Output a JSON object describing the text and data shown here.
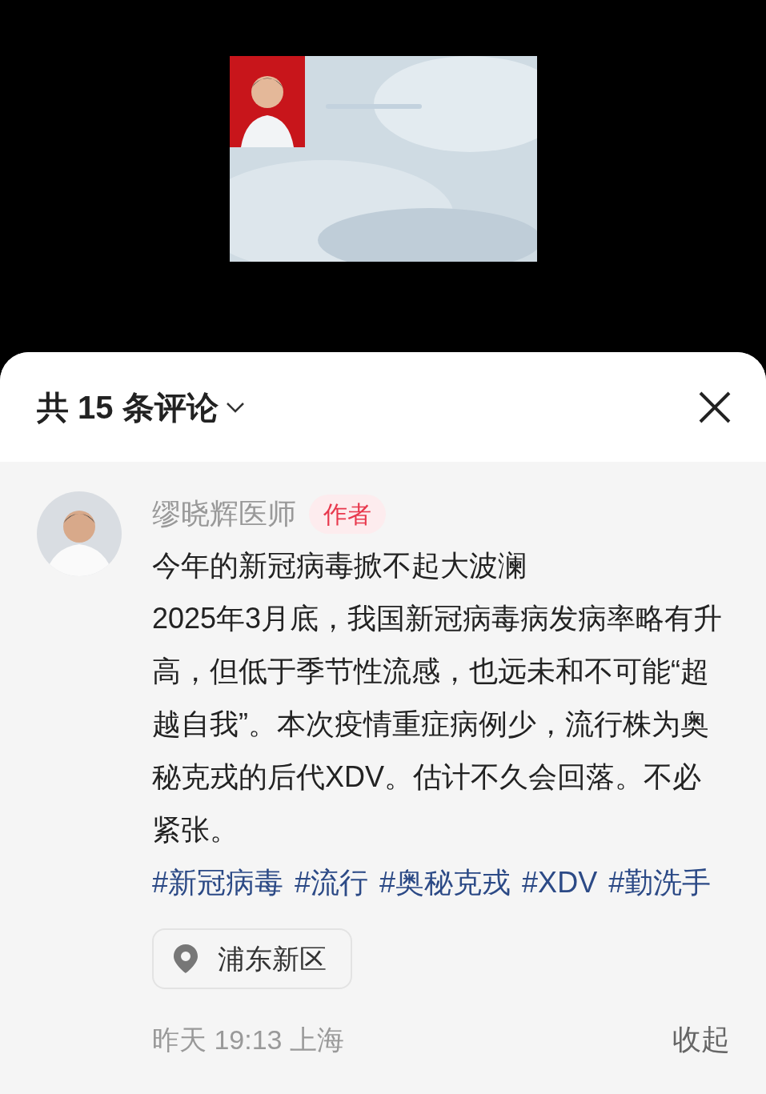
{
  "header": {
    "title": "共 15 条评论"
  },
  "comment": {
    "author": "缪晓辉医师",
    "badge": "作者",
    "title": "今年的新冠病毒掀不起大波澜",
    "body": "2025年3月底，我国新冠病毒病发病率略有升高，但低于季节性流感，也远未和不可能“超越自我”。本次疫情重症病例少，流行株为奥秘克戎的后代XDV。估计不久会回落。不必紧张。",
    "hashtags": [
      "#新冠病毒",
      "#流行",
      "#奥秘克戎",
      "#XDV",
      "#勤洗手"
    ],
    "location": "浦东新区",
    "time": "昨天 19:13 上海",
    "collapse": "收起"
  }
}
